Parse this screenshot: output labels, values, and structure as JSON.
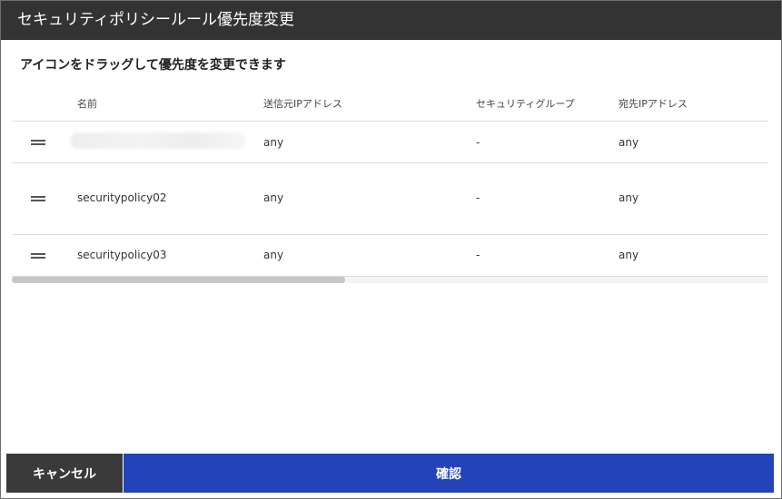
{
  "dialog": {
    "title": "セキュリティポリシールール優先度変更",
    "instruction": "アイコンをドラッグして優先度を変更できます"
  },
  "table": {
    "columns": [
      "名前",
      "送信元IPアドレス",
      "セキュリティグループ",
      "宛先IPアドレス"
    ],
    "rows": [
      {
        "name": "",
        "source_ip": "any",
        "security_group": "-",
        "dest_ip": "any"
      },
      {
        "name": "securitypolicy02",
        "source_ip": "any",
        "security_group": "-",
        "dest_ip": "any"
      },
      {
        "name": "securitypolicy03",
        "source_ip": "any",
        "security_group": "-",
        "dest_ip": "any"
      }
    ],
    "horizontal_scroll_fraction_visible": 0.44
  },
  "footer": {
    "cancel_label": "キャンセル",
    "confirm_label": "確認"
  },
  "colors": {
    "titlebar": "#333333",
    "cancel_button": "#3a3a3a",
    "confirm_button": "#2344b8",
    "row_divider": "#dcdcdc"
  },
  "icons": {
    "drag_handle": "drag-handle-icon"
  }
}
